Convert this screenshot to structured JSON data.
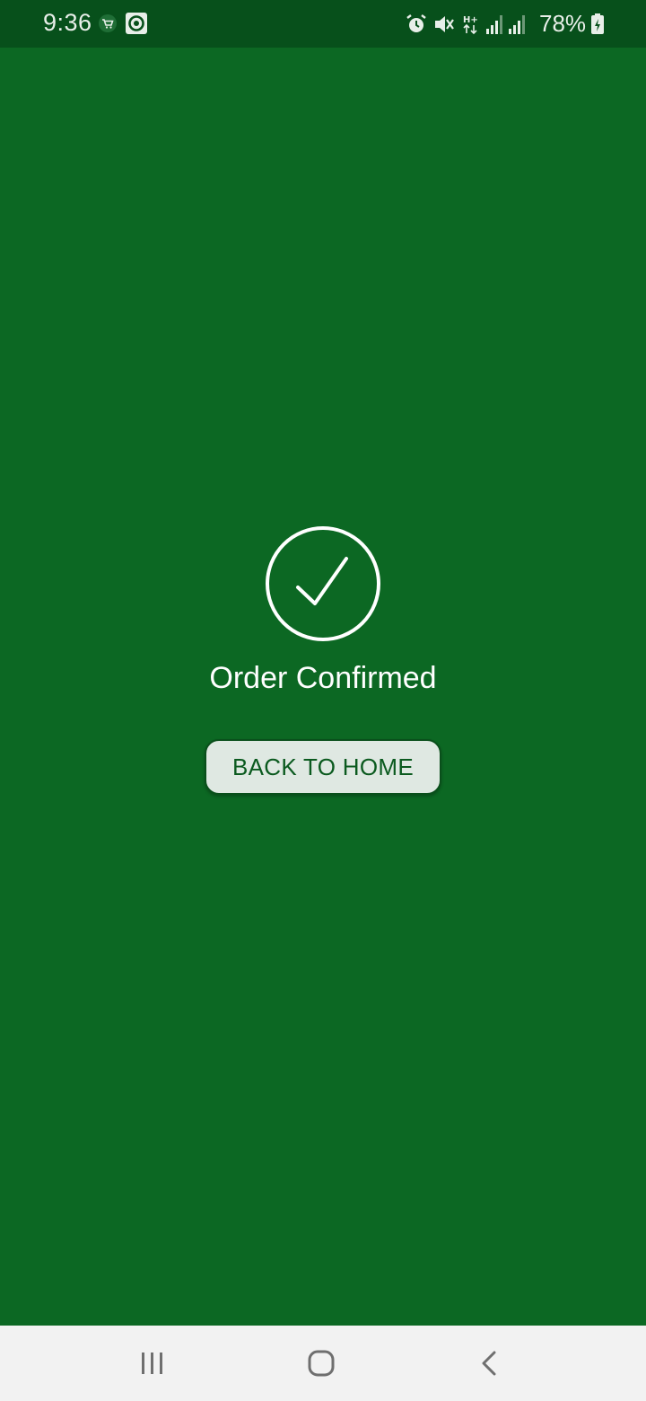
{
  "status_bar": {
    "time": "9:36",
    "battery_percent": "78%",
    "icons": [
      "shopping-cart-icon",
      "target-app-icon",
      "alarm-icon",
      "mute-icon",
      "network-h-plus-icon",
      "signal-icon",
      "signal-icon",
      "battery-charging-icon"
    ]
  },
  "confirmation": {
    "icon": "check-circle-icon",
    "title": "Order Confirmed",
    "button_label": "BACK TO HOME"
  },
  "nav_bar": {
    "buttons": [
      "recent-apps-icon",
      "home-icon",
      "back-icon"
    ]
  },
  "colors": {
    "background": "#0c6823",
    "status_bar": "#07501b",
    "button_bg": "#dfe8e2",
    "button_text": "#0b5a1f"
  }
}
